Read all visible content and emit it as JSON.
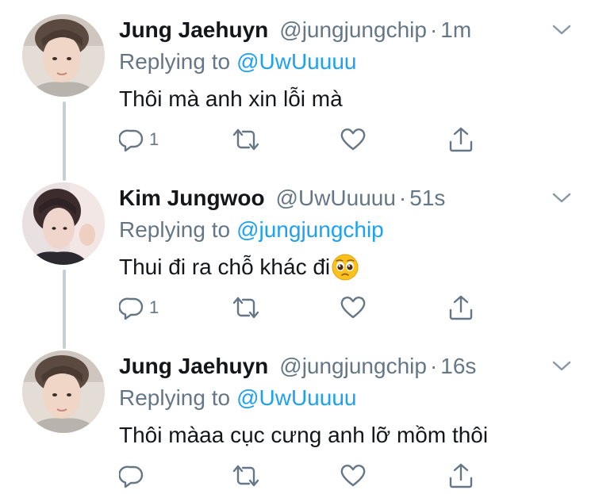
{
  "colors": {
    "name": "#14171a",
    "secondary": "#657786",
    "link": "#1da1f2",
    "thread_line": "#c4cfd6"
  },
  "tweets": [
    {
      "display_name": "Jung Jaehuyn",
      "handle": "@jungjungchip",
      "separator": "·",
      "time": "1m",
      "replying_label": "Replying to",
      "replying_to": "@UwUuuuu",
      "text": "Thôi mà anh xin lỗi mà",
      "emoji": "",
      "reply_count": "1",
      "icons": [
        "reply-icon",
        "retweet-icon",
        "like-icon",
        "share-icon"
      ]
    },
    {
      "display_name": "Kim Jungwoo",
      "handle": "@UwUuuuu",
      "separator": "·",
      "time": "51s",
      "replying_label": "Replying to",
      "replying_to": "@jungjungchip",
      "text": "Thui đi ra chỗ khác đi",
      "emoji": "pleading-face-emoji",
      "reply_count": "1",
      "icons": [
        "reply-icon",
        "retweet-icon",
        "like-icon",
        "share-icon"
      ]
    },
    {
      "display_name": "Jung Jaehuyn",
      "handle": "@jungjungchip",
      "separator": "·",
      "time": "16s",
      "replying_label": "Replying to",
      "replying_to": "@UwUuuuu",
      "text": "Thôi màaa cục cưng anh lỡ mồm thôi",
      "emoji": "",
      "reply_count": "",
      "icons": [
        "reply-icon",
        "retweet-icon",
        "like-icon",
        "share-icon"
      ]
    }
  ]
}
